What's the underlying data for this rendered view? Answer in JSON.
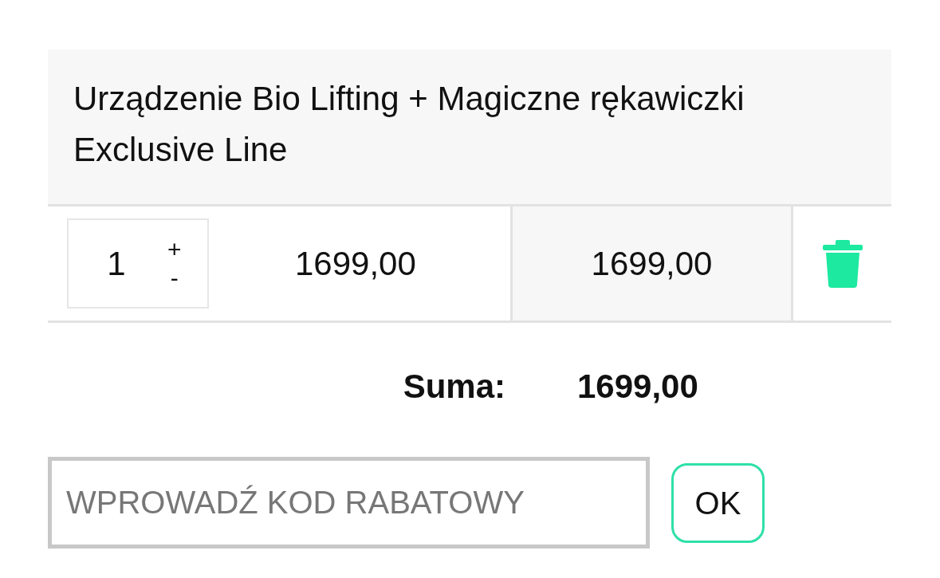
{
  "cart": {
    "product": {
      "name": "Urządzenie Bio Lifting + Magiczne rękawiczki Exclusive Line",
      "quantity": "1",
      "increment": "+",
      "decrement": "-",
      "unit_price": "1699,00",
      "line_total": "1699,00"
    }
  },
  "summary": {
    "label": "Suma:",
    "total": "1699,00"
  },
  "discount": {
    "placeholder": "WPROWADŹ KOD RABATOWY",
    "button": "OK"
  }
}
